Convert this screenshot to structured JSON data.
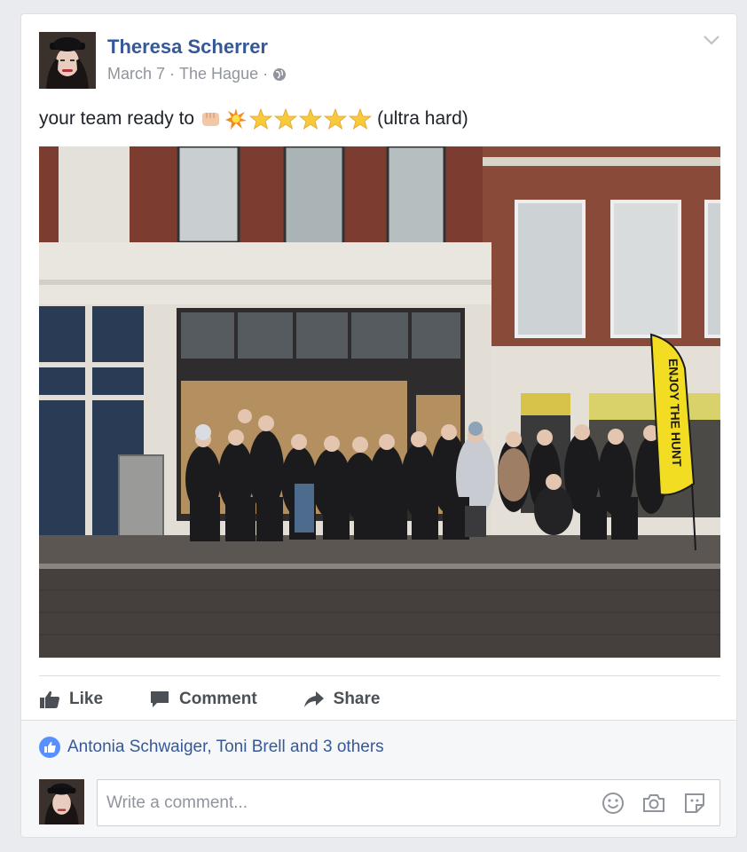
{
  "post": {
    "author": "Theresa Scherrer",
    "date": "March 7",
    "location": "The Hague",
    "separator": "·",
    "privacy_icon": "globe-icon",
    "text_before": "your team ready to",
    "emojis": [
      "fist-emoji",
      "collision-emoji",
      "star-emoji",
      "star-emoji",
      "star-emoji",
      "star-emoji",
      "star-emoji"
    ],
    "text_after": "(ultra hard)",
    "photo_flag_text": "ENJOY THE HUNT"
  },
  "actions": {
    "like": "Like",
    "comment": "Comment",
    "share": "Share"
  },
  "likes": {
    "summary": "Antonia Schwaiger, Toni Brell and 3 others"
  },
  "comment": {
    "placeholder": "Write a comment..."
  },
  "colors": {
    "link_blue": "#365899",
    "meta_gray": "#90949c",
    "like_blue": "#5890ff",
    "flag_yellow": "#f3dd22"
  }
}
